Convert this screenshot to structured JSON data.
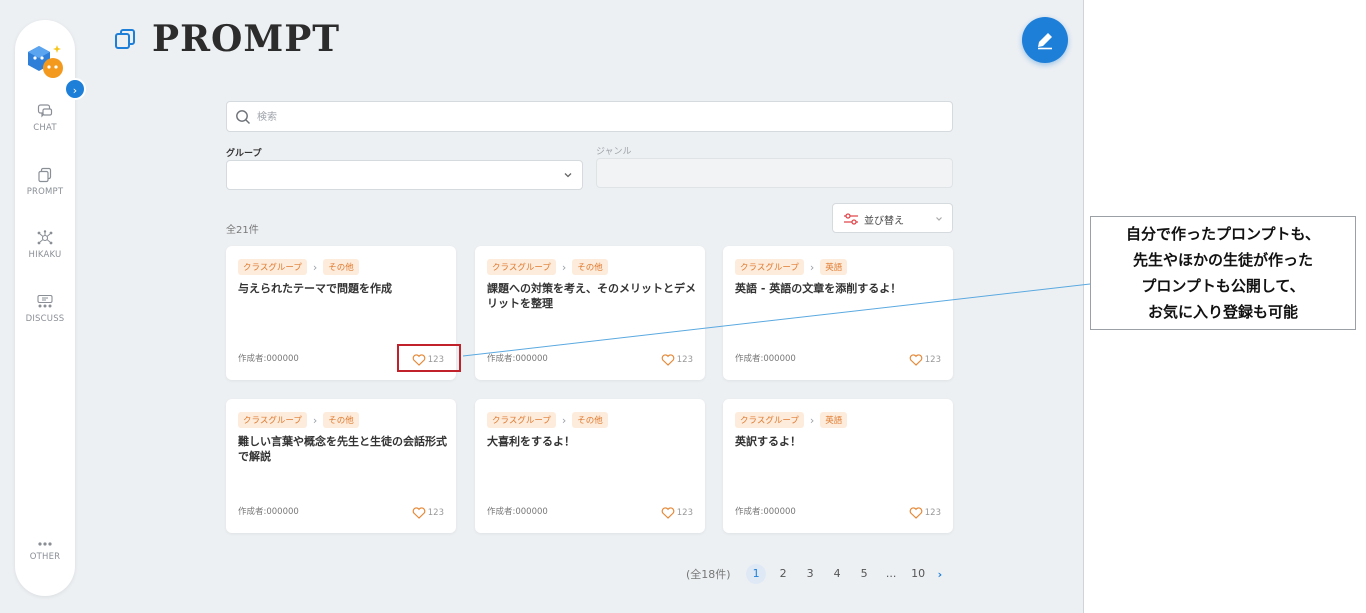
{
  "header": {
    "title": "PROMPT"
  },
  "sidebar": {
    "items": [
      {
        "label": "CHAT",
        "icon": "chat-icon"
      },
      {
        "label": "PROMPT",
        "icon": "prompt-icon"
      },
      {
        "label": "HIKAKU",
        "icon": "hikaku-icon"
      },
      {
        "label": "DISCUSS",
        "icon": "discuss-icon"
      }
    ],
    "other": {
      "label": "OTHER",
      "icon": "more-icon"
    },
    "expand_icon": "›"
  },
  "search": {
    "placeholder": "検索"
  },
  "filters": {
    "group_label": "グループ",
    "genre_label": "ジャンル",
    "sort_label": "並び替え"
  },
  "result_count": "全21件",
  "cards": [
    {
      "group": "クラスグループ",
      "genre": "その他",
      "title": "与えられたテーマで問題を作成",
      "author": "作成者:000000",
      "likes": "123"
    },
    {
      "group": "クラスグループ",
      "genre": "その他",
      "title": "課題への対策を考え、そのメリットとデメリットを整理",
      "author": "作成者:000000",
      "likes": "123"
    },
    {
      "group": "クラスグループ",
      "genre": "英語",
      "title": "英語 - 英語の文章を添削するよ！",
      "author": "作成者:000000",
      "likes": "123"
    },
    {
      "group": "クラスグループ",
      "genre": "その他",
      "title": "難しい言葉や概念を先生と生徒の会話形式で解説",
      "author": "作成者:000000",
      "likes": "123"
    },
    {
      "group": "クラスグループ",
      "genre": "その他",
      "title": "大喜利をするよ！",
      "author": "作成者:000000",
      "likes": "123"
    },
    {
      "group": "クラスグループ",
      "genre": "英語",
      "title": "英訳するよ！",
      "author": "作成者:000000",
      "likes": "123"
    }
  ],
  "pagination": {
    "total": "(全18件)",
    "pages": [
      "1",
      "2",
      "3",
      "4",
      "5",
      "...",
      "10"
    ],
    "current": "1",
    "next": "›"
  },
  "annotation": {
    "lines": [
      "自分で作ったプロンプトも、",
      "先生やほかの生徒が作った",
      "プロンプトも公開して、",
      "お気に入り登録も可能"
    ]
  },
  "colors": {
    "accent": "#1e7fd8",
    "tag_text": "#e07a2f",
    "tag_bg": "#fdecdc",
    "highlight": "#c0212b"
  }
}
